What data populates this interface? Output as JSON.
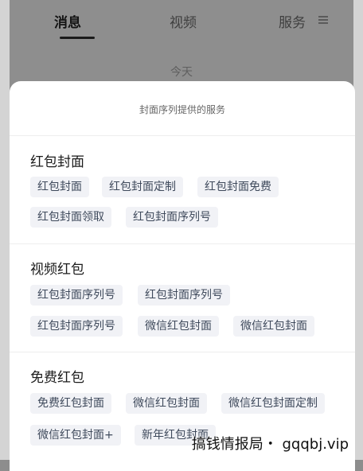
{
  "tabs": [
    {
      "label": "消息",
      "active": true
    },
    {
      "label": "视频",
      "active": false
    },
    {
      "label": "服务",
      "active": false
    }
  ],
  "date_label": "今天",
  "sheet": {
    "title": "封面序列提供的服务",
    "sections": [
      {
        "title": "红包封面",
        "chips": [
          "红包封面",
          "红包封面定制",
          "红包封面免费",
          "红包封面领取",
          "红包封面序列号"
        ]
      },
      {
        "title": "视频红包",
        "chips": [
          "红包封面序列号",
          "红包封面序列号",
          "红包封面序列号",
          "微信红包封面",
          "微信红包封面"
        ]
      },
      {
        "title": "免费红包",
        "chips": [
          "免费红包封面",
          "微信红包封面",
          "微信红包封面定制",
          "微信红包封面+",
          "新年红包封面"
        ]
      }
    ]
  },
  "watermark": "搞钱情报局・ gqqbj.vip",
  "colors": {
    "sheet_bg": "#ffffff",
    "chip_bg": "#f1f2f6",
    "chip_text": "#3f4a5c",
    "backdrop": "#8e8e8e"
  }
}
